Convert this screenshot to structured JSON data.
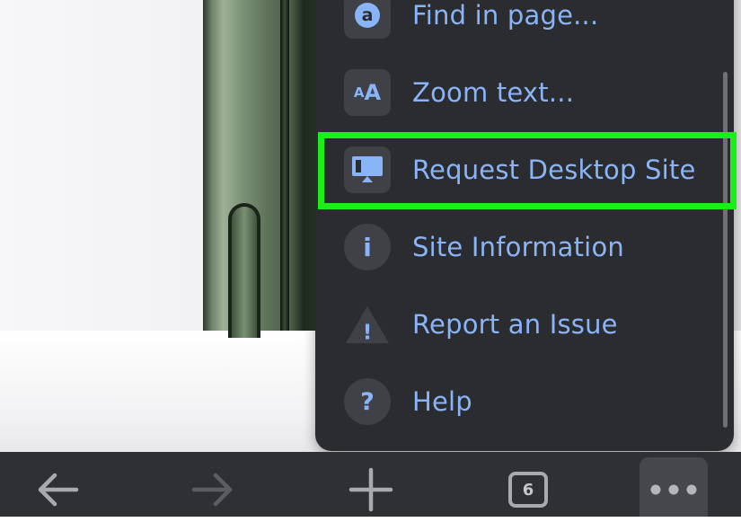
{
  "menu": {
    "items": [
      {
        "label": "Find in page...",
        "icon": "find-in-page-icon"
      },
      {
        "label": "Zoom text...",
        "icon": "zoom-text-icon",
        "icon_text": "AA"
      },
      {
        "label": "Request Desktop Site",
        "icon": "desktop-site-icon",
        "highlighted": true
      },
      {
        "label": "Site Information",
        "icon": "info-icon",
        "icon_text": "i"
      },
      {
        "label": "Report an Issue",
        "icon": "warning-icon",
        "icon_text": "!"
      },
      {
        "label": "Help",
        "icon": "help-icon",
        "icon_text": "?"
      }
    ]
  },
  "toolbar": {
    "back": "back-arrow-icon",
    "forward": "forward-arrow-icon",
    "new_tab": "plus-icon",
    "tab_count": "6",
    "more": "more-dots-icon"
  },
  "colors": {
    "menu_bg": "#2b2c2f",
    "menu_text": "#8ab4f8",
    "highlight": "#19f019",
    "toolbar_bg": "#2f3034"
  }
}
